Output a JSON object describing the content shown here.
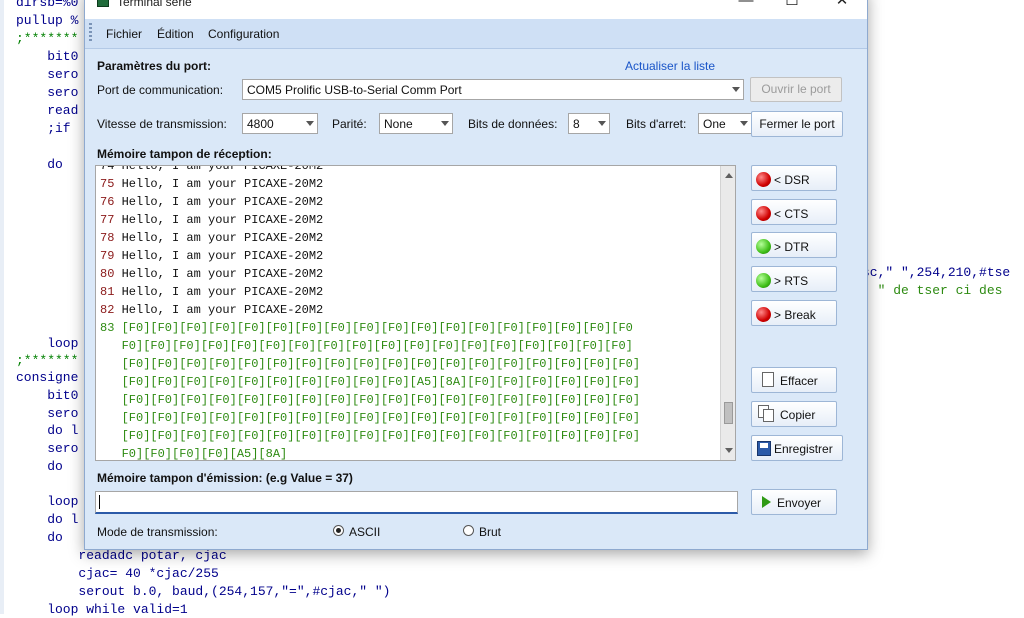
{
  "editor": {
    "lines": [
      {
        "text": "dirsb=%0"
      },
      {
        "text": "pullup %"
      },
      {
        "text": ";*******"
      },
      {
        "text": "    bit0"
      },
      {
        "text": "    sero"
      },
      {
        "text": "    sero"
      },
      {
        "text": "    read"
      },
      {
        "text": "    ;if"
      },
      {
        "text": "    do"
      },
      {
        "text": "    loop"
      },
      {
        "text": ";*******"
      },
      {
        "text": "consigne"
      },
      {
        "text": "    bit0"
      },
      {
        "text": "    sero"
      },
      {
        "text": "    do l"
      },
      {
        "text": "    sero"
      },
      {
        "text": "    do"
      },
      {
        "text": "    loop"
      },
      {
        "text": "    do l"
      },
      {
        "text": "    do"
      },
      {
        "text": "        readadc potar, cjac"
      },
      {
        "text": "        cjac= 40 *cjac/255"
      },
      {
        "text": "        serout b.0, baud,(254,157,\"=\",#cjac,\" \")"
      },
      {
        "text": "    loop while valid=1"
      }
    ],
    "right_line_1": "sc,\" \",254,210,#tse",
    "right_line_2": "\" \" de tser ci des"
  },
  "window": {
    "title": "Terminal série",
    "minimize_glyph": "—",
    "maximize_glyph": "☐",
    "close_glyph": "✕",
    "menu": [
      "Fichier",
      "Édition",
      "Configuration"
    ]
  },
  "port": {
    "section_label": "Paramètres du port:",
    "refresh_link": "Actualiser la liste",
    "com_label": "Port de communication:",
    "com_value": "COM5 Prolific USB-to-Serial Comm Port",
    "open_button": "Ouvrir le port",
    "speed_label": "Vitesse de transmission:",
    "speed_value": "4800",
    "parity_label": "Parité:",
    "parity_value": "None",
    "databits_label": "Bits de données:",
    "databits_value": "8",
    "stopbits_label": "Bits d'arret:",
    "stopbits_value": "One",
    "close_button": "Fermer le port"
  },
  "rx": {
    "label": "Mémoire tampon de réception:",
    "partial_line": "74 Hello, I am your PICAXE-20M2",
    "lines": [
      {
        "n": "75",
        "text": " Hello, I am your PICAXE-20M2"
      },
      {
        "n": "76",
        "text": " Hello, I am your PICAXE-20M2"
      },
      {
        "n": "77",
        "text": " Hello, I am your PICAXE-20M2"
      },
      {
        "n": "78",
        "text": " Hello, I am your PICAXE-20M2"
      },
      {
        "n": "79",
        "text": " Hello, I am your PICAXE-20M2"
      },
      {
        "n": "80",
        "text": " Hello, I am your PICAXE-20M2"
      },
      {
        "n": "81",
        "text": " Hello, I am your PICAXE-20M2"
      },
      {
        "n": "82",
        "text": " Hello, I am your PICAXE-20M2"
      }
    ],
    "hex_lines": [
      "83 [F0][F0][F0][F0][F0][F0][F0][F0][F0][F0][F0][F0][F0][F0][F0][F0][F0][F0",
      "   F0][F0][F0][F0][F0][F0][F0][F0][F0][F0][F0][F0][F0][F0][F0][F0][F0][F0]",
      "   [F0][F0][F0][F0][F0][F0][F0][F0][F0][F0][F0][F0][F0][F0][F0][F0][F0][F0]",
      "   [F0][F0][F0][F0][F0][F0][F0][F0][F0][F0][A5][8A][F0][F0][F0][F0][F0][F0]",
      "   [F0][F0][F0][F0][F0][F0][F0][F0][F0][F0][F0][F0][F0][F0][F0][F0][F0][F0]",
      "   [F0][F0][F0][F0][F0][F0][F0][F0][F0][F0][F0][F0][F0][F0][F0][F0][F0][F0]",
      "   [F0][F0][F0][F0][F0][F0][F0][F0][F0][F0][F0][F0][F0][F0][F0][F0][F0][F0]",
      "   F0][F0][F0][F0][A5][8A]"
    ]
  },
  "signals": [
    {
      "label": "< DSR",
      "state": "red"
    },
    {
      "label": "< CTS",
      "state": "red"
    },
    {
      "label": "> DTR",
      "state": "green"
    },
    {
      "label": "> RTS",
      "state": "green"
    },
    {
      "label": "> Break",
      "state": "red"
    }
  ],
  "actions": {
    "clear": "Effacer",
    "copy": "Copier",
    "save": "Enregistrer",
    "send": "Envoyer"
  },
  "tx": {
    "label": "Mémoire tampon d'émission: (e.g Value = 37)",
    "value": ""
  },
  "mode": {
    "label": "Mode de transmission:",
    "ascii": "ASCII",
    "raw": "Brut",
    "selected": "ASCII"
  },
  "colors": {
    "window_bg": "#dae8f8",
    "led_red": "#d00000",
    "led_green": "#3fbf18",
    "hex_text": "#2e8b12",
    "link": "#1a55c8"
  }
}
